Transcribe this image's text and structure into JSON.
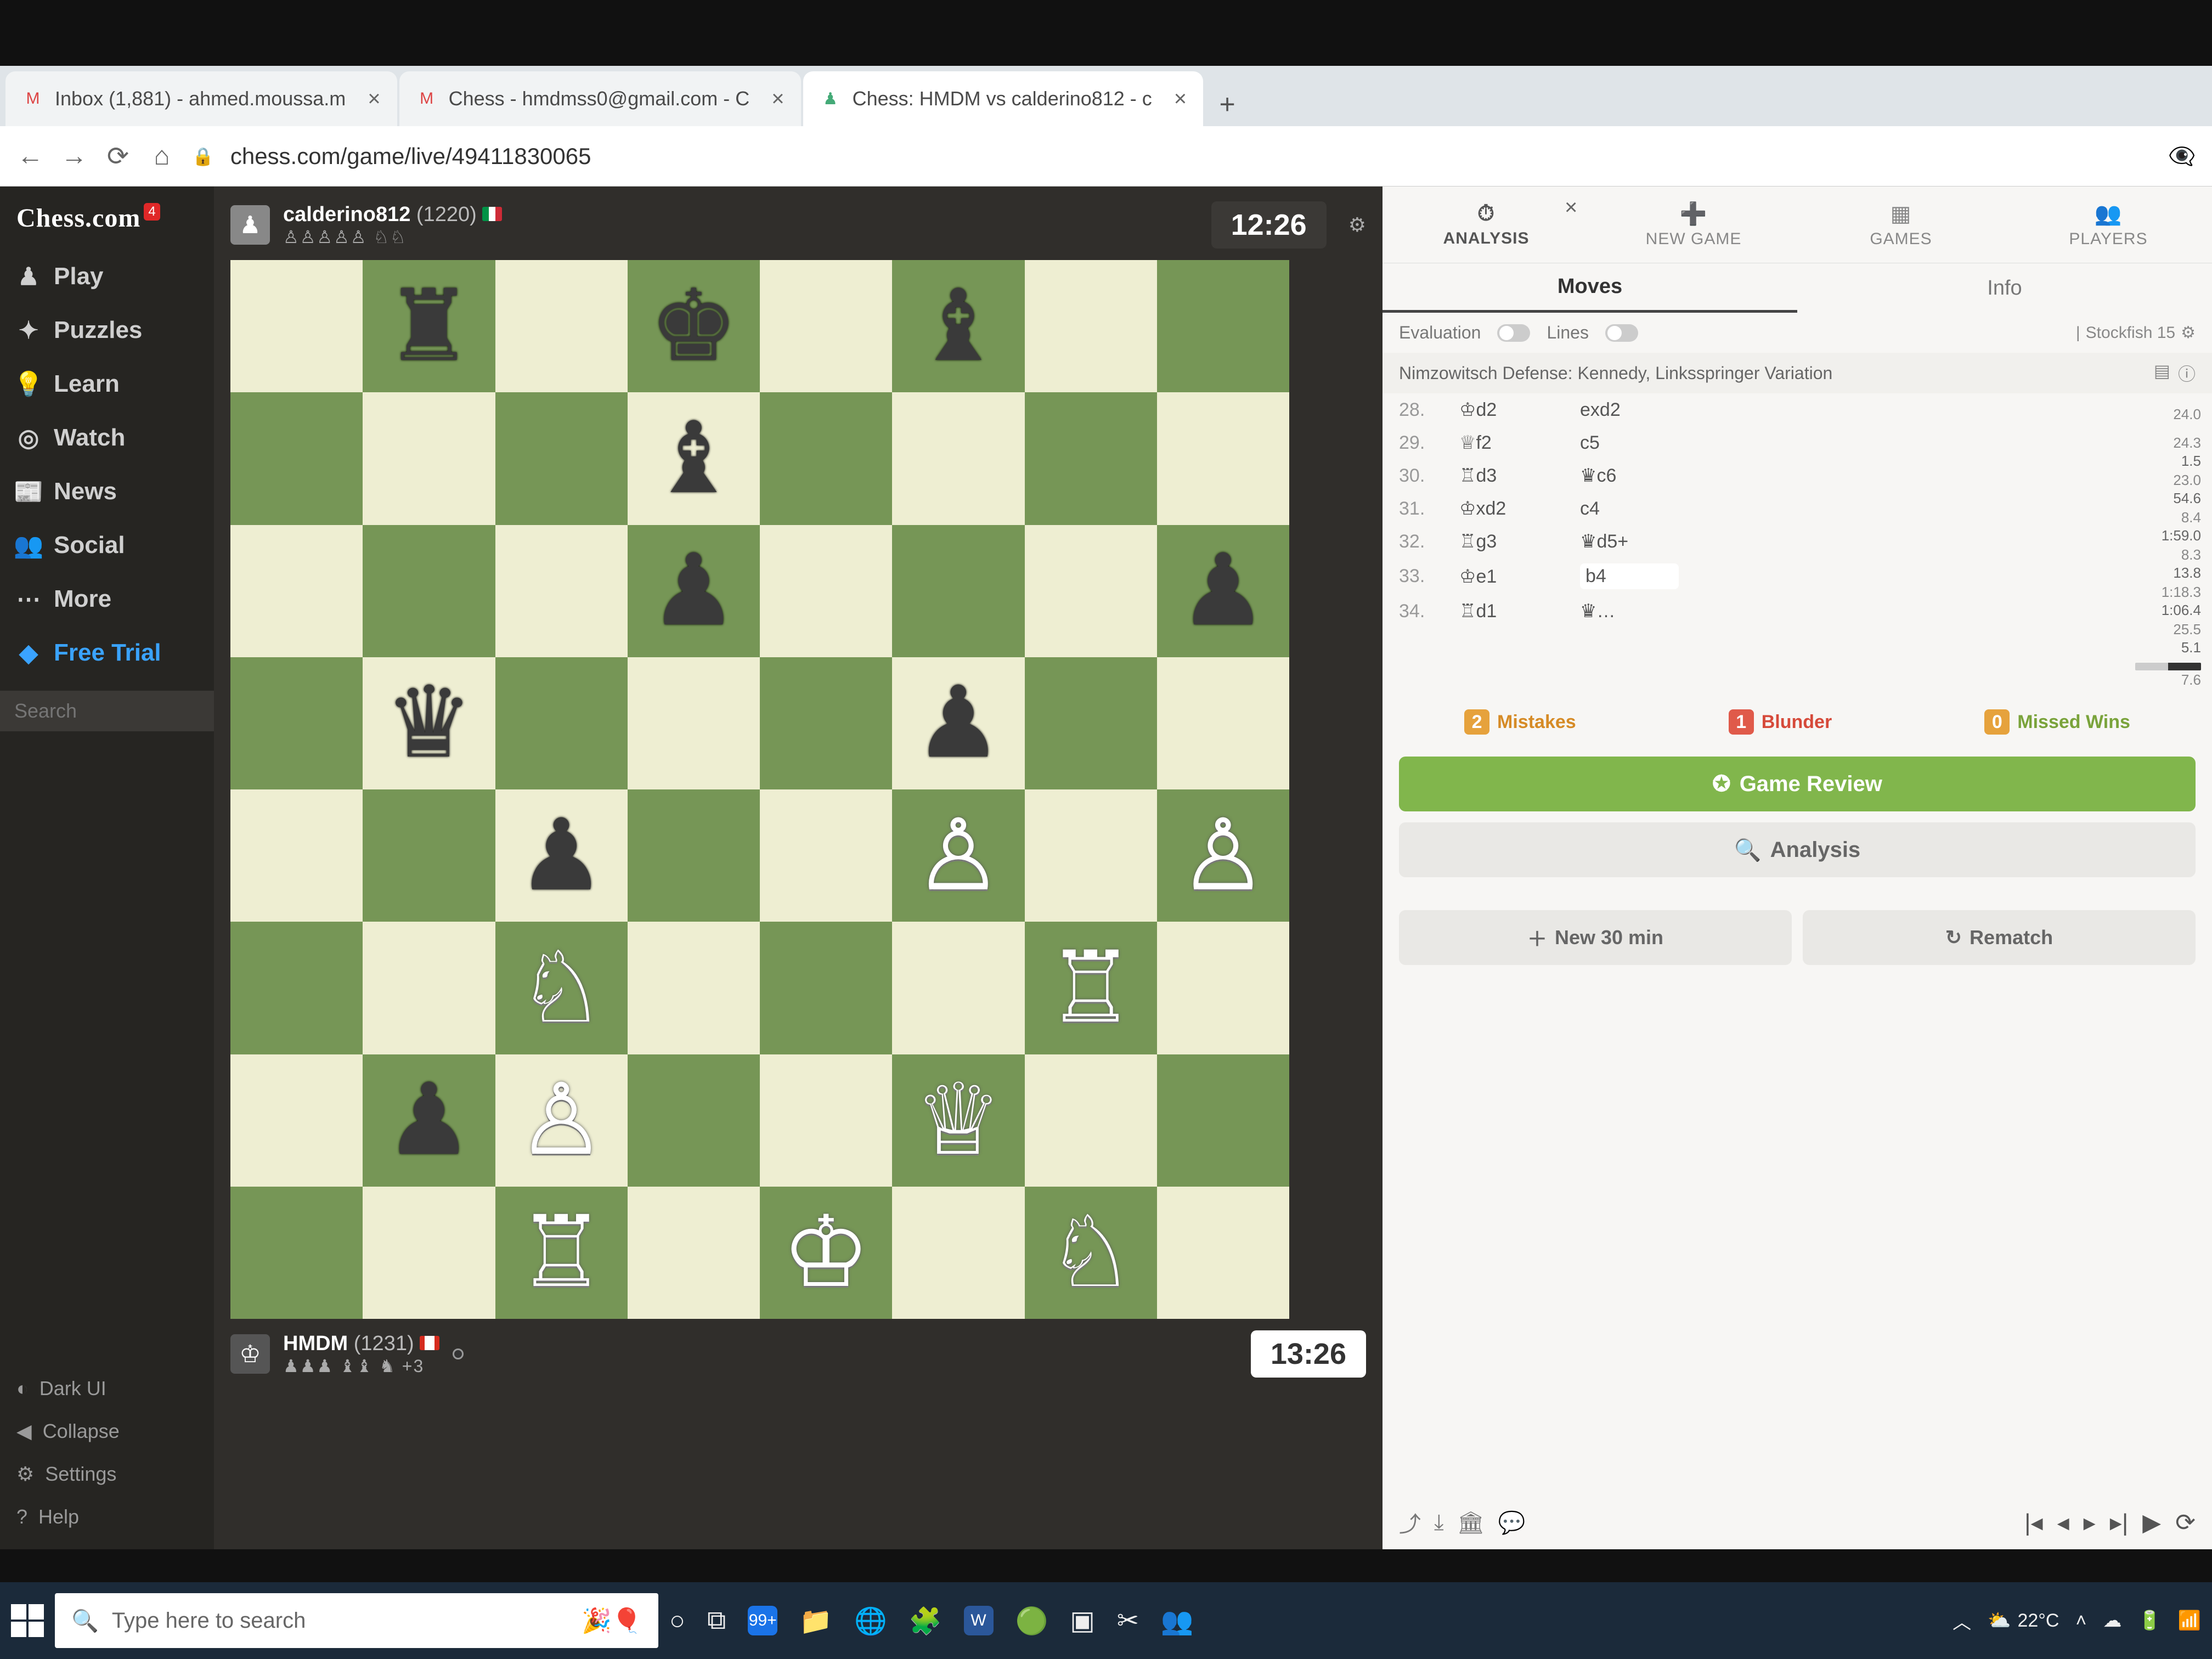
{
  "browser": {
    "tabs": [
      {
        "favicon": "M",
        "title": "Inbox (1,881) - ahmed.moussa.m"
      },
      {
        "favicon": "M",
        "title": "Chess - hmdmss0@gmail.com - C"
      },
      {
        "favicon": "♟",
        "title": "Chess: HMDM vs calderino812 - c"
      }
    ],
    "url": "chess.com/game/live/49411830065"
  },
  "sidebar": {
    "logo": "Chess.com",
    "badge": "4",
    "items": [
      {
        "icon": "♟",
        "label": "Play"
      },
      {
        "icon": "✦",
        "label": "Puzzles"
      },
      {
        "icon": "💡",
        "label": "Learn"
      },
      {
        "icon": "◎",
        "label": "Watch"
      },
      {
        "icon": "📰",
        "label": "News"
      },
      {
        "icon": "👥",
        "label": "Social"
      },
      {
        "icon": "⋯",
        "label": "More"
      },
      {
        "icon": "◆",
        "label": "Free Trial"
      }
    ],
    "search_placeholder": "Search",
    "bottom": [
      {
        "icon": "◐",
        "label": "Dark UI"
      },
      {
        "icon": "◀",
        "label": "Collapse"
      },
      {
        "icon": "⚙",
        "label": "Settings"
      },
      {
        "icon": "?",
        "label": "Help"
      }
    ]
  },
  "game": {
    "top_player": {
      "name": "calderino812",
      "rating": "(1220)",
      "country": "it",
      "captured": "♙♙♙♙♙ ♘♘",
      "clock": "12:26"
    },
    "bottom_player": {
      "name": "HMDM",
      "rating": "(1231)",
      "country": "ca",
      "captured": "♟♟♟ ♝♝ ♞  +3",
      "clock": "13:26"
    },
    "board": {
      "squares": [
        [
          "",
          "r",
          "",
          "k",
          "",
          "b",
          "",
          ""
        ],
        [
          "",
          "",
          "",
          "b",
          "",
          "",
          "",
          ""
        ],
        [
          "",
          "",
          "",
          "p",
          "",
          "",
          "",
          "p"
        ],
        [
          "",
          "q",
          "",
          "",
          "",
          "p",
          "",
          ""
        ],
        [
          "",
          "",
          "p",
          "",
          "",
          "P",
          "",
          "P"
        ],
        [
          "",
          "",
          "N",
          "",
          "",
          "",
          "R",
          ""
        ],
        [
          "",
          "p",
          "P",
          "",
          "",
          "Q",
          "",
          ""
        ],
        [
          "",
          "",
          "R",
          "",
          "K",
          "",
          "N",
          ""
        ]
      ]
    }
  },
  "panel": {
    "tabs": [
      "ANALYSIS",
      "NEW GAME",
      "GAMES",
      "PLAYERS"
    ],
    "subtabs": [
      "Moves",
      "Info"
    ],
    "toggles": {
      "eval": "Evaluation",
      "lines": "Lines",
      "engine": "Stockfish 15"
    },
    "opening": "Nimzowitsch Defense: Kennedy, Linksspringer Variation",
    "moves": [
      {
        "n": "28.",
        "w": "♔d2",
        "b": "exd2",
        "e1": "24.3",
        "e2": "1.5"
      },
      {
        "n": "29.",
        "w": "♕f2",
        "b": "c5",
        "e1": "23.0",
        "e2": "54.6"
      },
      {
        "n": "30.",
        "w": "♖d3",
        "b": "♛c6",
        "e1": "8.4",
        "e2": "1:59.0"
      },
      {
        "n": "31.",
        "w": "♔xd2",
        "b": "c4",
        "e1": "8.3",
        "e2": "13.8"
      },
      {
        "n": "32.",
        "w": "♖g3",
        "b": "♛d5+",
        "e1": "1:18.3",
        "e2": "1:06.4"
      },
      {
        "n": "33.",
        "w": "♔e1",
        "b": "b4",
        "e1": "25.5",
        "e2": "5.1"
      },
      {
        "n": "34.",
        "w": "♖d1",
        "b": "♛…",
        "e1": "7.6",
        "e2": ""
      }
    ],
    "prev_eval": "24.0",
    "summary": {
      "mistakes_n": "2",
      "mistakes": "Mistakes",
      "blunder_n": "1",
      "blunder": "Blunder",
      "missed_n": "0",
      "missed": "Missed Wins"
    },
    "buttons": {
      "review": "Game Review",
      "analysis": "Analysis",
      "new30": "New 30 min",
      "rematch": "Rematch"
    }
  },
  "taskbar": {
    "search_placeholder": "Type here to search",
    "temp": "22°C"
  }
}
